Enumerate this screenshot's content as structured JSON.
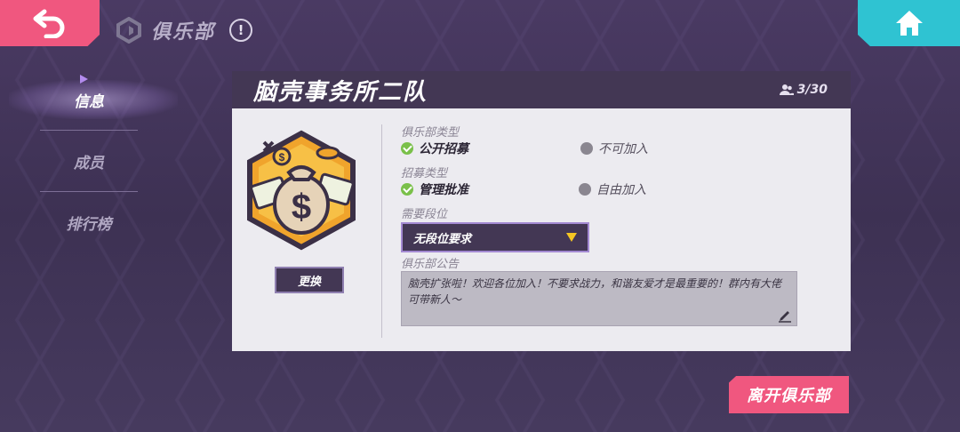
{
  "header": {
    "title": "俱乐部",
    "info_symbol": "!"
  },
  "sidebar": {
    "items": [
      {
        "label": "信息",
        "active": true
      },
      {
        "label": "成员",
        "active": false
      },
      {
        "label": "排行榜",
        "active": false
      }
    ]
  },
  "club": {
    "name": "脑壳事务所二队",
    "member_count": "3/30",
    "change_label": "更换"
  },
  "settings": {
    "club_type_label": "俱乐部类型",
    "club_type_options": [
      {
        "label": "公开招募",
        "selected": true
      },
      {
        "label": "不可加入",
        "selected": false
      }
    ],
    "recruit_type_label": "招募类型",
    "recruit_type_options": [
      {
        "label": "管理批准",
        "selected": true
      },
      {
        "label": "自由加入",
        "selected": false
      }
    ],
    "rank_label": "需要段位",
    "rank_value": "无段位要求",
    "notice_label": "俱乐部公告",
    "notice_text": "脑壳扩张啦！欢迎各位加入！不要求战力，和谐友爱才是最重要的！群内有大佬可带新人～"
  },
  "actions": {
    "leave_label": "离开俱乐部"
  },
  "colors": {
    "accent_pink": "#f0577f",
    "accent_cyan": "#2fc3d2",
    "panel_dark": "#433754",
    "check_green": "#7ac04a",
    "arrow_yellow": "#f5c623"
  },
  "icons": [
    "back-arrow-icon",
    "home-icon",
    "club-logo-icon",
    "info-icon",
    "members-icon",
    "check-icon",
    "edit-icon",
    "money-bag-emblem"
  ]
}
